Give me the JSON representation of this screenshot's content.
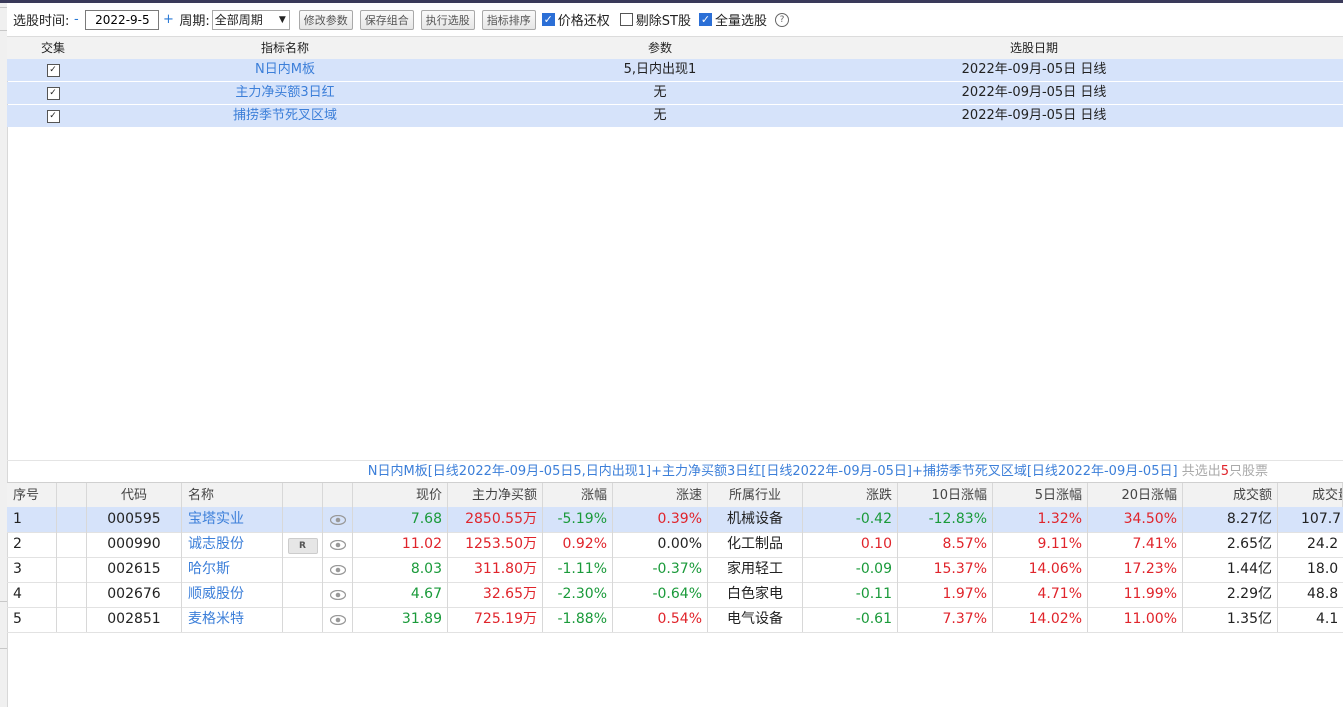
{
  "toolbar": {
    "date_label": "选股时间:",
    "minus": "-",
    "date_value": "2022-9-5",
    "plus": "+",
    "period_label": "周期:",
    "period_value": "全部周期",
    "btn_edit": "修改参数",
    "btn_save": "保存组合",
    "btn_run": "执行选股",
    "btn_sort": "指标排序",
    "chk_price": "价格还权",
    "chk_st": "剔除ST股",
    "chk_all": "全量选股",
    "help": "?"
  },
  "indicators": {
    "headers": {
      "intersect": "交集",
      "name": "指标名称",
      "params": "参数",
      "date": "选股日期"
    },
    "rows": [
      {
        "checked": "✓",
        "name": "N日内M板",
        "params": "5,日内出现1",
        "date": "2022年-09月-05日 日线"
      },
      {
        "checked": "✓",
        "name": "主力净买额3日红",
        "params": "无",
        "date": "2022年-09月-05日 日线"
      },
      {
        "checked": "✓",
        "name": "捕捞季节死叉区域",
        "params": "无",
        "date": "2022年-09月-05日 日线"
      }
    ]
  },
  "summary": {
    "text": "N日内M板[日线2022年-09月-05日5,日内出现1]+主力净买额3日红[日线2022年-09月-05日]+捕捞季节死叉区域[日线2022年-09月-05日]",
    "count_prefix": "共选出",
    "count": "5",
    "count_suffix": "只股票"
  },
  "results": {
    "headers": {
      "idx": "序号",
      "code": "代码",
      "name": "名称",
      "price": "现价",
      "netbuy": "主力净买额",
      "pct": "涨幅",
      "speed": "涨速",
      "industry": "所属行业",
      "change": "涨跌",
      "d10": "10日涨幅",
      "d5": "5日涨幅",
      "d20": "20日涨幅",
      "amount": "成交额",
      "vol": "成交量"
    },
    "rows": [
      {
        "idx": "1",
        "code": "000595",
        "name": "宝塔实业",
        "badge": "",
        "price": "7.68",
        "netbuy": "2850.55万",
        "pct": "-5.19%",
        "speed": "0.39%",
        "industry": "机械设备",
        "change": "-0.42",
        "d10": "-12.83%",
        "d5": "1.32%",
        "d20": "34.50%",
        "amount": "8.27亿",
        "vol": "107.7"
      },
      {
        "idx": "2",
        "code": "000990",
        "name": "诚志股份",
        "badge": "R",
        "price": "11.02",
        "netbuy": "1253.50万",
        "pct": "0.92%",
        "speed": "0.00%",
        "industry": "化工制品",
        "change": "0.10",
        "d10": "8.57%",
        "d5": "9.11%",
        "d20": "7.41%",
        "amount": "2.65亿",
        "vol": "24.2"
      },
      {
        "idx": "3",
        "code": "002615",
        "name": "哈尔斯",
        "badge": "",
        "price": "8.03",
        "netbuy": "311.80万",
        "pct": "-1.11%",
        "speed": "-0.37%",
        "industry": "家用轻工",
        "change": "-0.09",
        "d10": "15.37%",
        "d5": "14.06%",
        "d20": "17.23%",
        "amount": "1.44亿",
        "vol": "18.0"
      },
      {
        "idx": "4",
        "code": "002676",
        "name": "顺威股份",
        "badge": "",
        "price": "4.67",
        "netbuy": "32.65万",
        "pct": "-2.30%",
        "speed": "-0.64%",
        "industry": "白色家电",
        "change": "-0.11",
        "d10": "1.97%",
        "d5": "4.71%",
        "d20": "11.99%",
        "amount": "2.29亿",
        "vol": "48.8"
      },
      {
        "idx": "5",
        "code": "002851",
        "name": "麦格米特",
        "badge": "",
        "price": "31.89",
        "netbuy": "725.19万",
        "pct": "-1.88%",
        "speed": "0.54%",
        "industry": "电气设备",
        "change": "-0.61",
        "d10": "7.37%",
        "d5": "14.02%",
        "d20": "11.00%",
        "amount": "1.35亿",
        "vol": "4.1"
      }
    ]
  },
  "colors": {
    "up": "#e0242b",
    "down": "#1a9a3a",
    "link": "#3c7fd9",
    "selected_row": "#d6e3fa"
  }
}
